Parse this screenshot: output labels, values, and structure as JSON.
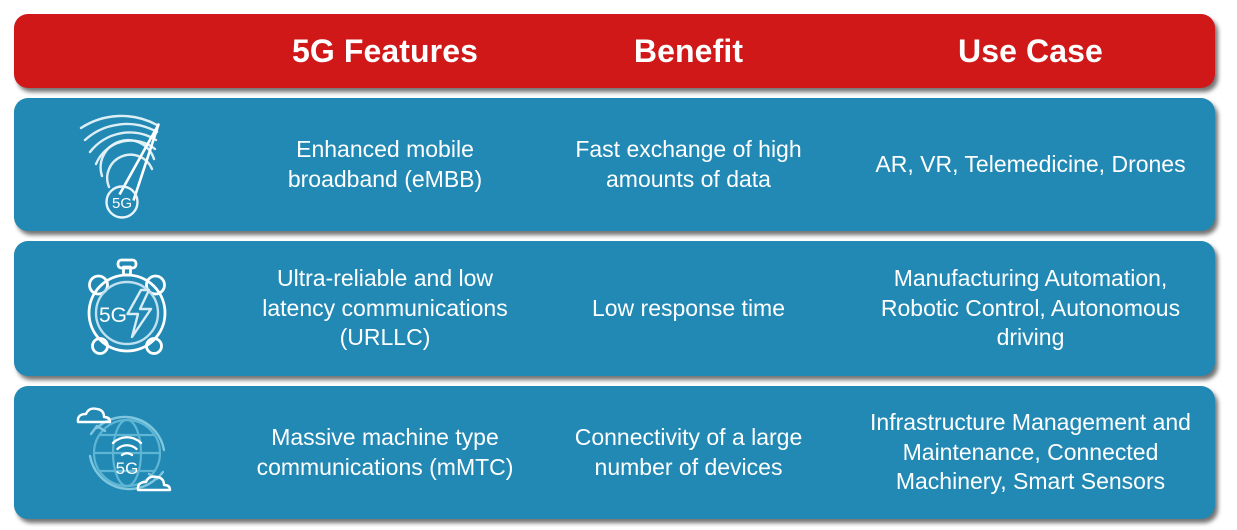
{
  "colors": {
    "header_bg": "#d01819",
    "row_bg": "#2189b4",
    "text": "#ffffff",
    "icon_stroke": "#ffffff",
    "icon_stroke_dim": "#bfe0ee"
  },
  "header": {
    "columns": [
      {
        "label": "",
        "name": "icon-header"
      },
      {
        "label": "5G Features",
        "name": "header-5g-features"
      },
      {
        "label": "Benefit",
        "name": "header-benefit"
      },
      {
        "label": "Use Case",
        "name": "header-use-case"
      }
    ]
  },
  "rows": [
    {
      "icon": "5g-signal-meter-icon",
      "icon_label": "5G",
      "feature": "Enhanced mobile broadband (eMBB)",
      "benefit": "Fast exchange of high amounts of data",
      "use_case": "AR, VR, Telemedicine, Drones"
    },
    {
      "icon": "5g-stopwatch-lightning-icon",
      "icon_label": "5G",
      "feature": "Ultra-reliable and low latency communications (URLLC)",
      "benefit": "Low response time",
      "use_case": "Manufacturing Automation, Robotic Control, Autonomous driving"
    },
    {
      "icon": "5g-globe-cloud-icon",
      "icon_label": "5G",
      "feature": "Massive machine type communications (mMTC)",
      "benefit": "Connectivity of a large number of devices",
      "use_case": "Infrastructure Management and Maintenance, Connected Machinery, Smart Sensors"
    }
  ]
}
